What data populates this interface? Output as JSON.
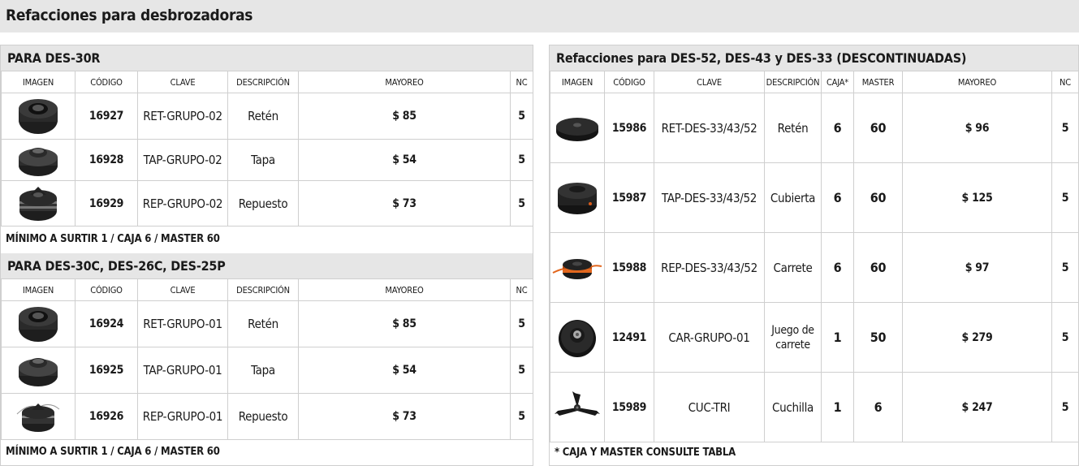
{
  "page": {
    "title": "Refacciones para desbrozadoras"
  },
  "left": {
    "section1": {
      "title": "PARA DES-30R",
      "headers": {
        "imagen": "IMAGEN",
        "codigo": "CÓDIGO",
        "clave": "CLAVE",
        "descripcion": "DESCRIPCIÓN",
        "mayoreo": "MAYOREO",
        "nc": "NC"
      },
      "rows": [
        {
          "image": "retainer-nut-icon",
          "codigo": "16927",
          "clave": "RET-GRUPO-02",
          "descripcion": "Retén",
          "mayoreo": "$ 85",
          "nc": "5"
        },
        {
          "image": "spool-cap-icon",
          "codigo": "16928",
          "clave": "TAP-GRUPO-02",
          "descripcion": "Tapa",
          "mayoreo": "$ 54",
          "nc": "5"
        },
        {
          "image": "spool-refill-icon",
          "codigo": "16929",
          "clave": "REP-GRUPO-02",
          "descripcion": "Repuesto",
          "mayoreo": "$ 73",
          "nc": "5"
        }
      ],
      "note": "MÍNIMO A SURTIR 1 / CAJA 6 / MASTER 60"
    },
    "section2": {
      "title": "PARA DES-30C, DES-26C, DES-25P",
      "headers": {
        "imagen": "IMAGEN",
        "codigo": "CÓDIGO",
        "clave": "CLAVE",
        "descripcion": "DESCRIPCIÓN",
        "mayoreo": "MAYOREO",
        "nc": "NC"
      },
      "rows": [
        {
          "image": "retainer-nut-icon",
          "codigo": "16924",
          "clave": "RET-GRUPO-01",
          "descripcion": "Retén",
          "mayoreo": "$ 85",
          "nc": "5"
        },
        {
          "image": "spool-cap-icon",
          "codigo": "16925",
          "clave": "TAP-GRUPO-01",
          "descripcion": "Tapa",
          "mayoreo": "$ 54",
          "nc": "5"
        },
        {
          "image": "spool-refill-icon",
          "codigo": "16926",
          "clave": "REP-GRUPO-01",
          "descripcion": "Repuesto",
          "mayoreo": "$ 73",
          "nc": "5"
        }
      ],
      "note": "MÍNIMO A SURTIR 1 / CAJA 6 / MASTER 60"
    }
  },
  "right": {
    "title": "Refacciones para DES-52, DES-43 y DES-33 (DESCONTINUADAS)",
    "headers": {
      "imagen": "IMAGEN",
      "codigo": "CÓDIGO",
      "clave": "CLAVE",
      "descripcion": "DESCRIPCIÓN",
      "caja": "CAJA*",
      "master": "MASTER",
      "mayoreo": "MAYOREO",
      "nc": "NC"
    },
    "rows": [
      {
        "image": "retainer-disc-icon",
        "codigo": "15986",
        "clave": "RET-DES-33/43/52",
        "descripcion": "Retén",
        "caja": "6",
        "master": "60",
        "mayoreo": "$ 96",
        "nc": "5"
      },
      {
        "image": "cover-icon",
        "codigo": "15987",
        "clave": "TAP-DES-33/43/52",
        "descripcion": "Cubierta",
        "caja": "6",
        "master": "60",
        "mayoreo": "$ 125",
        "nc": "5"
      },
      {
        "image": "line-spool-icon",
        "codigo": "15988",
        "clave": "REP-DES-33/43/52",
        "descripcion": "Carrete",
        "caja": "6",
        "master": "60",
        "mayoreo": "$ 97",
        "nc": "5"
      },
      {
        "image": "spool-set-icon",
        "codigo": "12491",
        "clave": "CAR-GRUPO-01",
        "descripcion": "Juego de carrete",
        "caja": "1",
        "master": "50",
        "mayoreo": "$ 279",
        "nc": "5"
      },
      {
        "image": "blade-icon",
        "codigo": "15989",
        "clave": "CUC-TRI",
        "descripcion": "Cuchilla",
        "caja": "1",
        "master": "6",
        "mayoreo": "$ 247",
        "nc": "5"
      }
    ],
    "note": "* CAJA Y MASTER CONSULTE TABLA"
  }
}
